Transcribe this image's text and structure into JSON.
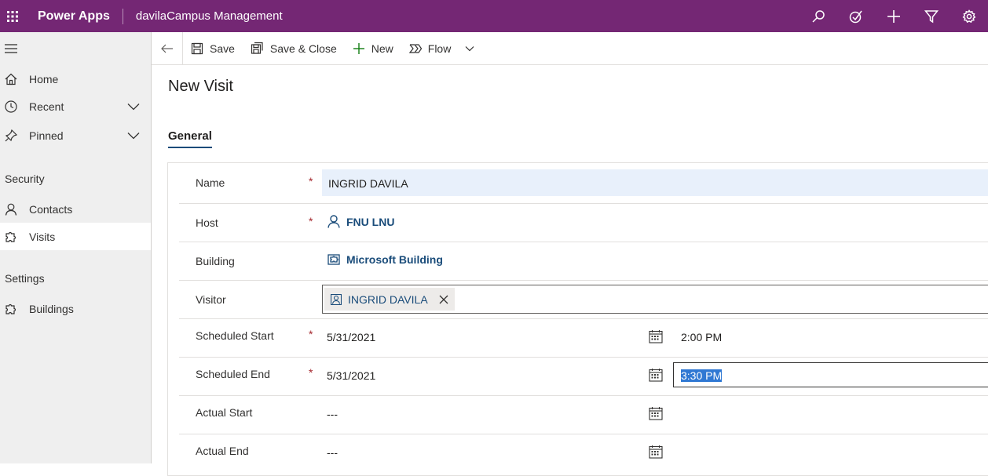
{
  "topbar": {
    "app_name": "Power Apps",
    "environment": "davilaCampus Management",
    "icons": [
      "waffle-icon",
      "search-icon",
      "task-icon",
      "plus-icon",
      "filter-icon",
      "settings-icon"
    ],
    "color": "#742774"
  },
  "sidebar": {
    "items": [
      {
        "label": "Home",
        "icon": "home-icon"
      },
      {
        "label": "Recent",
        "icon": "clock-icon"
      },
      {
        "label": "Pinned",
        "icon": "pin-icon"
      }
    ],
    "groups": [
      {
        "title": "Security",
        "items": [
          {
            "label": "Contacts",
            "icon": "person-icon"
          },
          {
            "label": "Visits",
            "icon": "puzzle-icon"
          }
        ]
      },
      {
        "title": "Settings",
        "items": [
          {
            "label": "Buildings",
            "icon": "puzzle-icon"
          }
        ]
      }
    ]
  },
  "commandbar": {
    "save": "Save",
    "save_close": "Save & Close",
    "new": "New",
    "flow": "Flow"
  },
  "form": {
    "title": "New Visit",
    "tab": "General",
    "fields": {
      "name": {
        "label": "Name",
        "required": "*",
        "value": "INGRID DAVILA"
      },
      "host": {
        "label": "Host",
        "required": "*",
        "value": "FNU LNU"
      },
      "building": {
        "label": "Building",
        "value": "Microsoft Building"
      },
      "visitor": {
        "label": "Visitor",
        "value": "INGRID DAVILA"
      },
      "scheduled_start": {
        "label": "Scheduled Start",
        "required": "*",
        "date": "5/31/2021",
        "time": "2:00 PM"
      },
      "scheduled_end": {
        "label": "Scheduled End",
        "required": "*",
        "date": "5/31/2021",
        "time": "3:30 PM"
      },
      "actual_start": {
        "label": "Actual Start",
        "date": "---"
      },
      "actual_end": {
        "label": "Actual End",
        "date": "---"
      }
    }
  }
}
